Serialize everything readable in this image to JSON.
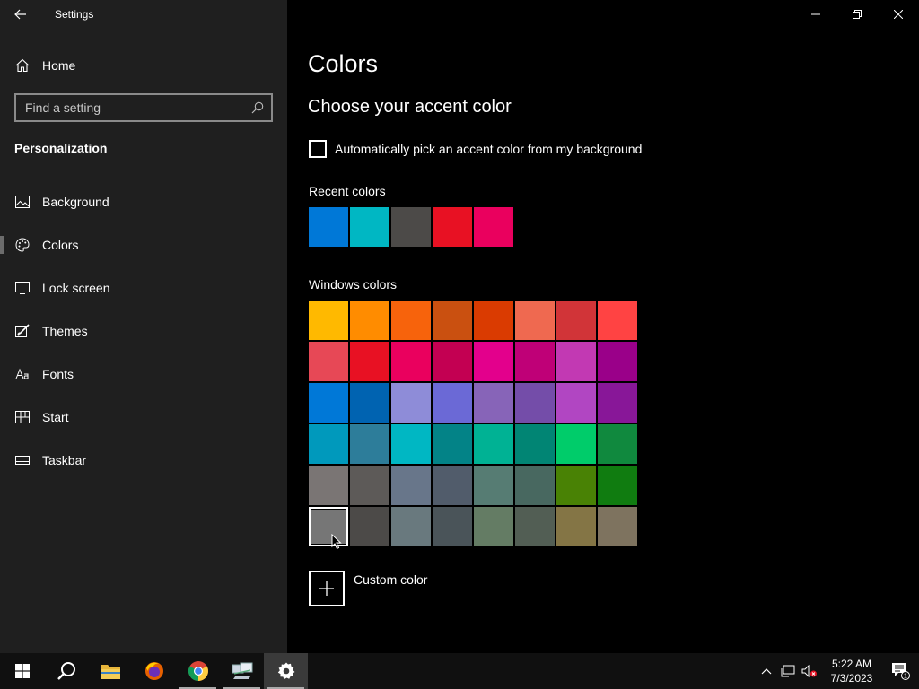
{
  "window": {
    "title": "Settings"
  },
  "sidebar": {
    "home_label": "Home",
    "search_placeholder": "Find a setting",
    "section_title": "Personalization",
    "items": [
      {
        "label": "Background",
        "icon": "image-icon",
        "selected": false
      },
      {
        "label": "Colors",
        "icon": "palette-icon",
        "selected": true
      },
      {
        "label": "Lock screen",
        "icon": "lock-screen-icon",
        "selected": false
      },
      {
        "label": "Themes",
        "icon": "themes-icon",
        "selected": false
      },
      {
        "label": "Fonts",
        "icon": "fonts-icon",
        "selected": false
      },
      {
        "label": "Start",
        "icon": "start-icon",
        "selected": false
      },
      {
        "label": "Taskbar",
        "icon": "taskbar-icon",
        "selected": false
      }
    ]
  },
  "main": {
    "page_title": "Colors",
    "subtitle": "Choose your accent color",
    "auto_accent_label": "Automatically pick an accent color from my background",
    "auto_accent_checked": false,
    "recent_label": "Recent colors",
    "recent_colors": [
      "#0078d7",
      "#00b7c3",
      "#4c4a48",
      "#e81123",
      "#ea005e"
    ],
    "windows_label": "Windows colors",
    "windows_colors": [
      "#ffb900",
      "#ff8c00",
      "#f7630c",
      "#ca5010",
      "#da3b01",
      "#ef6950",
      "#d13438",
      "#ff4343",
      "#e74856",
      "#e81123",
      "#ea005e",
      "#c30052",
      "#e3008c",
      "#bf0077",
      "#c239b3",
      "#9a0089",
      "#0078d7",
      "#0063b1",
      "#8e8cd8",
      "#6b69d6",
      "#8764b8",
      "#744da9",
      "#b146c2",
      "#881798",
      "#0099bc",
      "#2d7d9a",
      "#00b7c3",
      "#038387",
      "#00b294",
      "#018574",
      "#00cc6a",
      "#10893e",
      "#7a7574",
      "#5d5a58",
      "#68768a",
      "#515c6b",
      "#567c73",
      "#486860",
      "#498205",
      "#107c10",
      "#767676",
      "#4c4a48",
      "#69797e",
      "#4a5459",
      "#647c64",
      "#525e54",
      "#847545",
      "#7e735f"
    ],
    "selected_windows_color_index": 40,
    "custom_color_label": "Custom color"
  },
  "taskbar": {
    "apps": [
      {
        "name": "start-button",
        "running": false,
        "active": false
      },
      {
        "name": "search-button",
        "running": false,
        "active": false
      },
      {
        "name": "file-explorer",
        "running": false,
        "active": false
      },
      {
        "name": "firefox",
        "running": false,
        "active": false
      },
      {
        "name": "chrome",
        "running": true,
        "active": false
      },
      {
        "name": "network-app",
        "running": true,
        "active": false
      },
      {
        "name": "settings",
        "running": true,
        "active": true
      }
    ],
    "time": "5:22 AM",
    "date": "7/3/2023",
    "notification_count": "1"
  },
  "colors": {
    "sidebar_bg": "#1f1f1f",
    "main_bg": "#000000",
    "taskbar_bg": "#101010"
  }
}
